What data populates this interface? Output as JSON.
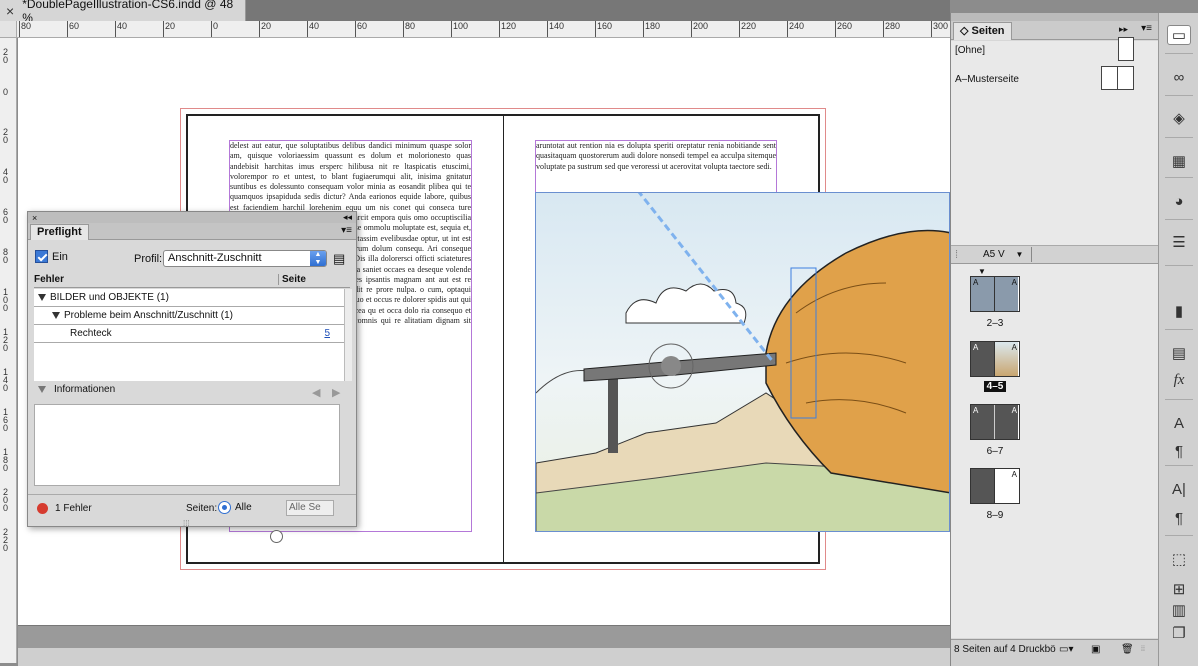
{
  "document": {
    "tab_title": "*DoublePageIllustration-CS6.indd @ 48 %",
    "close_glyph": "×"
  },
  "rulers": {
    "horizontal_ticks": [
      "80",
      "60",
      "40",
      "20",
      "0",
      "20",
      "40",
      "60",
      "80",
      "100",
      "120",
      "140",
      "160",
      "180",
      "200",
      "220",
      "240",
      "260",
      "280",
      "300"
    ],
    "vertical_ticks": [
      "2 0",
      "0",
      "2 0",
      "4 0",
      "6 0",
      "8 0",
      "1 0 0",
      "1 2 0",
      "1 4 0",
      "1 6 0",
      "1 8 0",
      "2 0 0",
      "2 2 0"
    ]
  },
  "spread": {
    "left_text_top": "delest aut eatur, que soluptatibus delibus dandici minimum quaspe solor am, quisque voloriaessim quassunt es dolum et molorionesto quas andebisit harchitas imus ersperc hilibusa nit re ltaspicatis etuscimi, volorempor ro et untest, to blant fugiaerumqui alit, inisima gnitatur suntibus es dolessunto consequam volor minia as eosandit plibea qui te quamquos ipsapiduda sedis dictur? Anda earionos equide labore, quibus est faciendiem harchil lorehenim equu",
    "left_text_right": "um nis conet qui conseca ture cetureru ptatiunt, quat. um que pro bearcit empora quis omo occuptiscilia del im rehenis ipsapicit es sintis quaesse ommolu moluptate est, sequia et, in pa volupti est et libusci lcilla moluptassim evelibusdae optur, ut int est harit fuga. Et ut venim eum ssum serum dolum consequ. Ari conseque quae vel ipsus. que quatatur, quatiur? Dis illa dolorersci officti sciatetures et ressit qui doluptat. eum nonseque ma saniet occaes ea deseque volende bisquam alis escid et essitorum que es ipsantis magnam ant aut est re spelisc iistios dit labo. m derempos dit re prore nulpa. o cum, optaqui audae consequam spidis quiandaecea quo et occus re dolorer spidis aut qui optur, optatur ipsum. lolupta quiandaecea qu et occa dolo ria consequo et et occatiumq de cus veritam si non comnis qui re alitatiam dignam sit permam",
    "right_text_top": "aruntotat aut rention nia es dolupta speriti oreptatur renia nobitiande sent quasitaquam quostorerum audi dolore nonsedi tempel ea acculpa sitemque voluptate pa sustrum sed que veroressi ut acerovitat volupta taectore sedi."
  },
  "preflight": {
    "title": "Preflight",
    "enabled_label": "Ein",
    "profile_label": "Profil:",
    "profile_value": "Anschnitt-Zuschnitt",
    "col_error": "Fehler",
    "col_page": "Seite",
    "tree": [
      {
        "label": "BILDER und OBJEKTE (1)",
        "page": ""
      },
      {
        "label": "Probleme beim Anschnitt/Zuschnitt (1)",
        "page": ""
      },
      {
        "label": "Rechteck",
        "page": "5"
      }
    ],
    "info_label": "Informationen",
    "error_count": "1 Fehler",
    "pages_label": "Seiten:",
    "opt_all": "Alle",
    "opt_pages_field": "Alle Se",
    "status_color": "#d63b2f"
  },
  "pages_panel": {
    "title": "Seiten",
    "masters": [
      {
        "label": "[Ohne]"
      },
      {
        "label": "A–Musterseite"
      }
    ],
    "page_size": "A5 V",
    "spreads": [
      {
        "label": "2–3",
        "left_letter": "A",
        "right_letter": "A",
        "selected": false
      },
      {
        "label": "4–5",
        "left_letter": "A",
        "right_letter": "A",
        "selected": true
      },
      {
        "label": "6–7",
        "left_letter": "A",
        "right_letter": "A",
        "selected": false
      },
      {
        "label": "8–9",
        "left_letter": "",
        "right_letter": "A",
        "selected": false
      }
    ],
    "footer": "8 Seiten auf 4 Druckbö"
  },
  "tools": [
    "pages-icon",
    "links-icon",
    "layers-icon",
    "swatches-icon",
    "color-icon",
    "stroke-icon",
    "gradient-icon",
    "text-wrap-icon",
    "effects-icon",
    "character-styles-icon",
    "paragraph-styles-icon",
    "character-icon",
    "paragraph-icon",
    "transform-icon",
    "align-icon",
    "table-icon",
    "object-styles-icon"
  ],
  "tool_glyphs": {
    "effects-icon": "fx",
    "character-icon": "A|",
    "paragraph-icon": "¶"
  }
}
